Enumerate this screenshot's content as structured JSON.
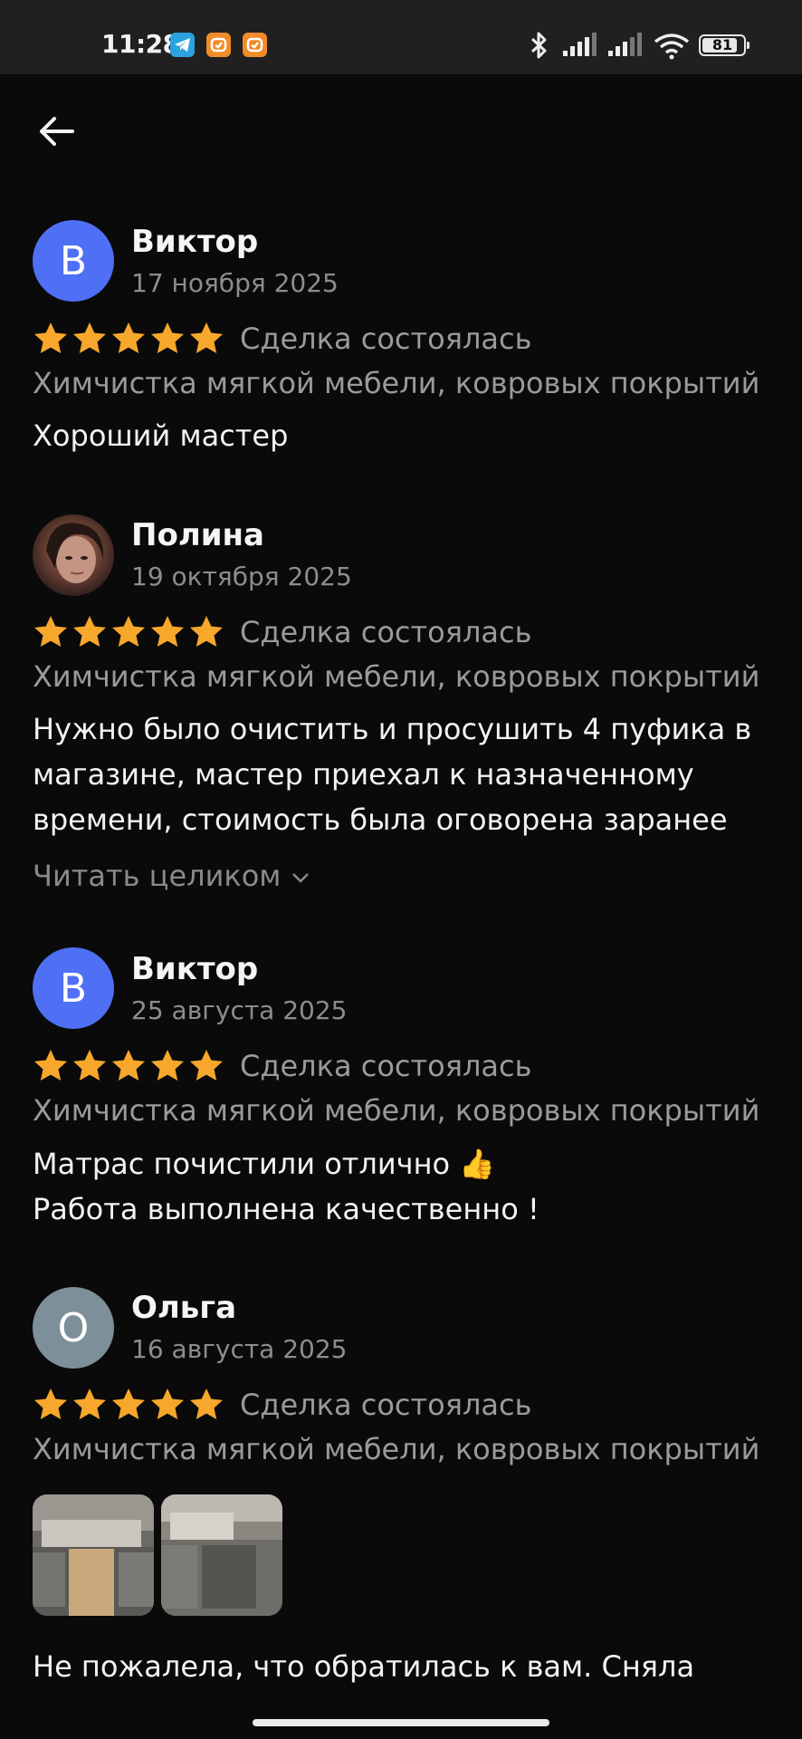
{
  "status_bar": {
    "time": "11:28",
    "battery": "81",
    "icons": [
      "telegram-icon",
      "notification-icon",
      "notification-icon",
      "bluetooth-icon",
      "signal-icon",
      "signal-icon",
      "wifi-icon",
      "battery-icon"
    ]
  },
  "nav": {
    "back_icon": "arrow-left-icon"
  },
  "colors": {
    "background": "#0a0a0a",
    "star": "#f7a72b",
    "avatar_blue": "#4f6ff5",
    "avatar_gray": "#7d8f98"
  },
  "reviews": [
    {
      "initial": "В",
      "name": "Виктор",
      "date": "17 ноября 2025",
      "rating": 5,
      "deal_status": "Сделка состоялась",
      "category": "Химчистка мягкой мебели, ковровых покрытий",
      "text": "Хороший мастер"
    },
    {
      "initial": "",
      "name": "Полина",
      "date": "19 октября 2025",
      "rating": 5,
      "deal_status": "Сделка состоялась",
      "category": "Химчистка мягкой мебели, ковровых покрытий",
      "text_lines": [
        "Нужно было очистить и просушить 4 пуфика в",
        "магазине, мастер приехал к назначенному",
        "времени, стоимость была оговорена заранее"
      ],
      "read_more": "Читать целиком"
    },
    {
      "initial": "В",
      "name": "Виктор",
      "date": "25 августа 2025",
      "rating": 5,
      "deal_status": "Сделка состоялась",
      "category": "Химчистка мягкой мебели, ковровых покрытий",
      "text_lines": [
        "Матрас почистили отлично 👍",
        "Работа выполнена качественно !"
      ]
    },
    {
      "initial": "О",
      "name": "Ольга",
      "date": "16 августа 2025",
      "rating": 5,
      "deal_status": "Сделка состоялась",
      "category": "Химчистка мягкой мебели, ковровых покрытий",
      "photos": 2,
      "text_lines": [
        "Не пожалела, что обратилась к вам. Сняла"
      ]
    }
  ]
}
